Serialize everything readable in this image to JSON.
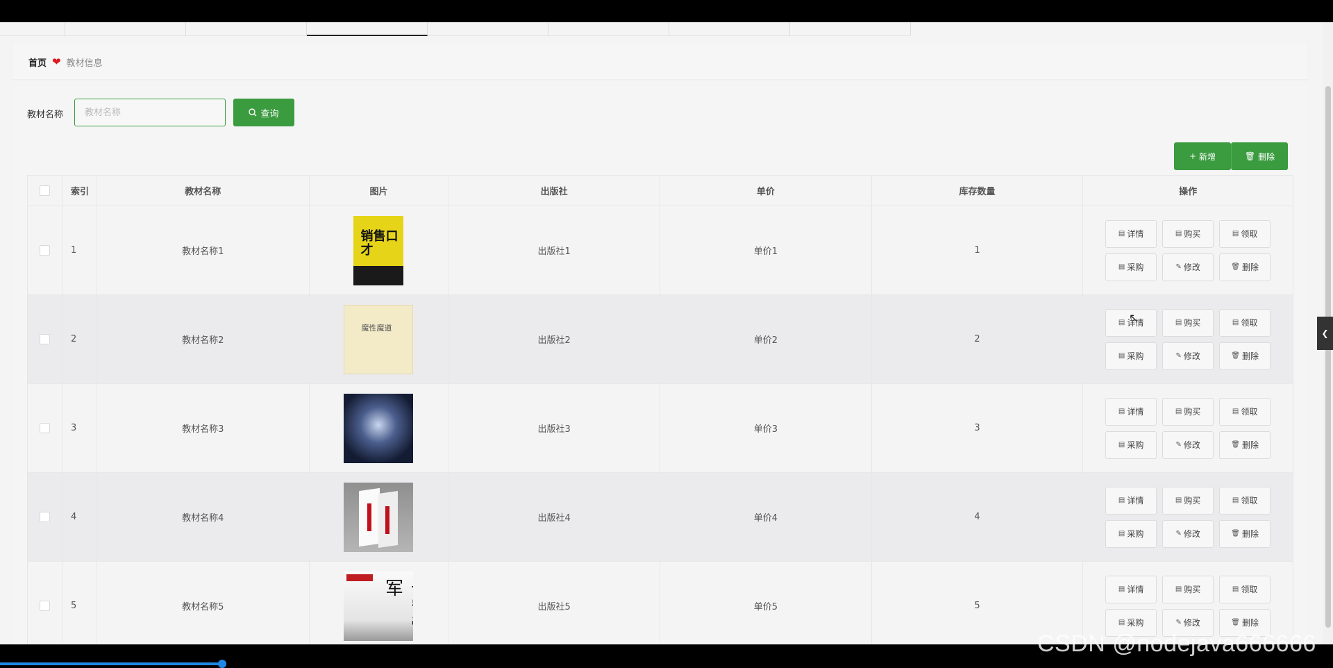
{
  "breadcrumb": {
    "home": "首页",
    "current": "教材信息"
  },
  "search": {
    "label": "教材名称",
    "placeholder": "教材名称",
    "button_label": "查询"
  },
  "toolbar": {
    "add_label": "新增",
    "delete_label": "删除"
  },
  "table": {
    "columns": [
      "索引",
      "教材名称",
      "图片",
      "出版社",
      "单价",
      "库存数量",
      "操作"
    ],
    "rows": [
      {
        "index": "1",
        "name": "教材名称1",
        "publisher": "出版社1",
        "price": "单价1",
        "stock": "1",
        "cover_text": "销售口才"
      },
      {
        "index": "2",
        "name": "教材名称2",
        "publisher": "出版社2",
        "price": "单价2",
        "stock": "2",
        "cover_text": "魔性魔道"
      },
      {
        "index": "3",
        "name": "教材名称3",
        "publisher": "出版社3",
        "price": "单价3",
        "stock": "3"
      },
      {
        "index": "4",
        "name": "教材名称4",
        "publisher": "出版社4",
        "price": "单价4",
        "stock": "4"
      },
      {
        "index": "5",
        "name": "教材名称5",
        "publisher": "出版社5",
        "price": "单价5",
        "stock": "5",
        "cover_text": "长宁帝军"
      }
    ],
    "row_actions": {
      "detail": "详情",
      "buy": "购买",
      "receive": "领取",
      "purchase": "采购",
      "edit": "修改",
      "delete": "删除"
    }
  },
  "watermark": "CSDN @nodejava666666",
  "colors": {
    "primary": "#3a9b3f",
    "heart": "#e0161e",
    "progress": "#1e88e5"
  }
}
